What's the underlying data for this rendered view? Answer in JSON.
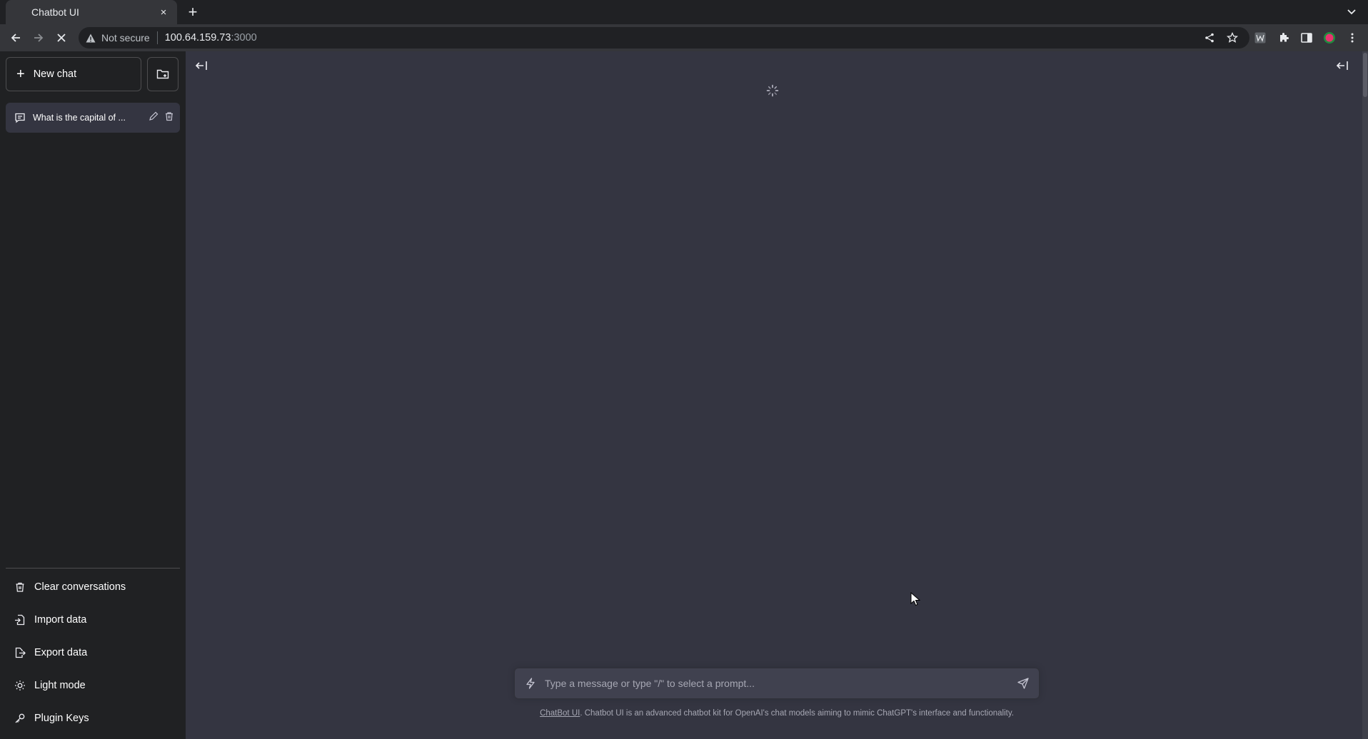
{
  "browser": {
    "tab_title": "Chatbot UI",
    "tab_close_glyph": "×",
    "new_tab_glyph": "+",
    "security_label": "Not secure",
    "url_host": "100.64.159.73",
    "url_port": ":3000"
  },
  "sidebar": {
    "new_chat_label": "New chat",
    "new_chat_glyph": "+",
    "conversations": [
      {
        "title": "What is the capital of ..."
      }
    ],
    "bottom_items": [
      {
        "label": "Clear conversations",
        "icon": "trash-icon"
      },
      {
        "label": "Import data",
        "icon": "file-import-icon"
      },
      {
        "label": "Export data",
        "icon": "file-export-icon"
      },
      {
        "label": "Light mode",
        "icon": "sun-icon"
      },
      {
        "label": "Plugin Keys",
        "icon": "key-icon"
      }
    ]
  },
  "main": {
    "input_placeholder": "Type a message or type \"/\" to select a prompt...",
    "footer_link": "ChatBot UI",
    "footer_text": ". Chatbot UI is an advanced chatbot kit for OpenAI's chat models aiming to mimic ChatGPT's interface and functionality."
  },
  "colors": {
    "sidebar_bg": "#202123",
    "main_bg": "#343541",
    "input_bg": "#40414f",
    "browser_chrome": "#35363a"
  }
}
